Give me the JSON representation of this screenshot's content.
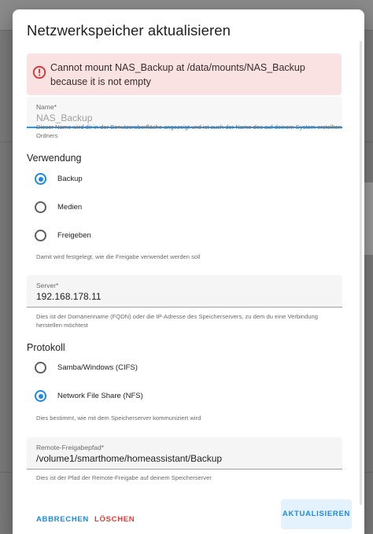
{
  "dialog": {
    "title": "Netzwerkspeicher aktualisieren"
  },
  "alert": {
    "icon": "alert-circle-icon",
    "message": "Cannot mount NAS_Backup at /data/mounts/NAS_Backup because it is not empty",
    "color": "#fbe2e2"
  },
  "name_field": {
    "label": "Name*",
    "value": "NAS_Backup",
    "helper": "Dieser Name wird dir in der Benutzeroberfläche angezeigt und ist auch der Name des auf deinem System erstellten Ordners"
  },
  "usage": {
    "title": "Verwendung",
    "options": [
      {
        "label": "Backup",
        "checked": true
      },
      {
        "label": "Medien",
        "checked": false
      },
      {
        "label": "Freigeben",
        "checked": false
      }
    ],
    "helper": "Damit wird festgelegt, wie die Freigabe verwendet werden soll"
  },
  "server_field": {
    "label": "Server*",
    "value": "192.168.178.11",
    "helper": "Dies ist der Domänenname (FQDN) oder die IP-Adresse des Speicherservers, zu dem du eine Verbindung herstellen möchtest"
  },
  "protocol": {
    "title": "Protokoll",
    "options": [
      {
        "label": "Samba/Windows (CIFS)",
        "checked": false
      },
      {
        "label": "Network File Share (NFS)",
        "checked": true
      }
    ],
    "helper": "Dies bestimmt, wie mit dem Speicherserver kommuniziert wird"
  },
  "path_field": {
    "label": "Remote-Freigabepfad*",
    "value": "/volume1/smarthome/homeassistant/Backup",
    "helper": "Dies ist der Pfad der Remote-Freigabe auf deinem Speicherserver"
  },
  "footer": {
    "cancel_label": "ABBRECHEN",
    "delete_label": "LÖSCHEN",
    "update_label": "AKTUALISIEREN"
  },
  "colors": {
    "accent": "#1e88e5",
    "danger": "#e53935"
  }
}
